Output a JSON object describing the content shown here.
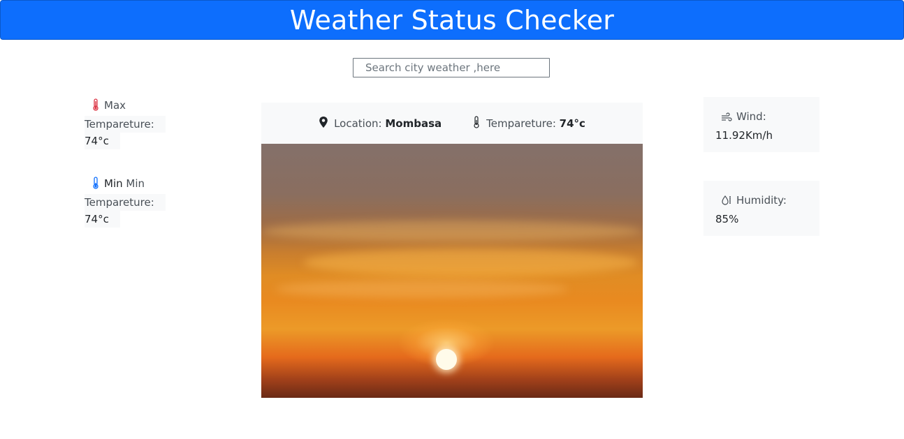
{
  "header": {
    "title": "Weather Status Checker"
  },
  "search": {
    "placeholder": "Search city weather ,here"
  },
  "max_temp": {
    "label_a": "Max",
    "label_b": "Tempareture:",
    "value": "74°c"
  },
  "min_temp": {
    "label_bold": "Min",
    "label_a": "Min",
    "label_b": "Tempareture:",
    "value": "74°c"
  },
  "summary": {
    "location_label": "Location:",
    "location_value": "Mombasa",
    "temp_label": "Tempareture:",
    "temp_value": "74°c"
  },
  "wind": {
    "label": "Wind:",
    "value": "11.92Km/h"
  },
  "humidity": {
    "label": "Humidity:",
    "value": "85%"
  },
  "icons": {
    "max": "thermometer-high-icon",
    "min": "thermometer-low-icon",
    "location": "geo-pin-icon",
    "temp": "thermometer-icon",
    "wind": "wind-icon",
    "humidity": "droplet-icon"
  },
  "colors": {
    "header_bg": "#0d6efd",
    "max_icon": "#dc3545",
    "min_icon": "#0d6efd",
    "card_bg": "#f8f9fa"
  }
}
